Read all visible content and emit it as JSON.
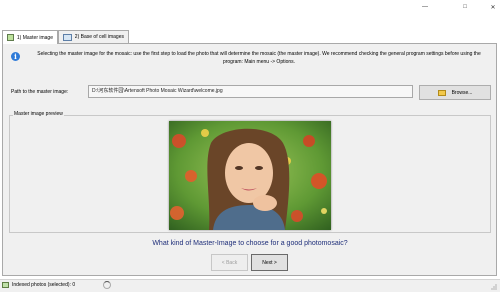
{
  "window": {
    "minimize_glyph": "—",
    "maximize_glyph": "□",
    "close_glyph": "✕"
  },
  "tabs": [
    {
      "label": "1) Master image"
    },
    {
      "label": "2) Base of cell images"
    }
  ],
  "info": {
    "text": "Selecting the master image for the mosaic: use the first step to load the photo that will determine the mosaic (the master image). We recommend checking the general program settings before using the program: Main menu -> Options."
  },
  "path": {
    "label": "Path to the master image:",
    "value": "D:\\河东软件园\\Artensoft Photo Mosaic Wizard\\welcome.jpg",
    "browse_label": "Browse..."
  },
  "preview": {
    "title": "Master image preview"
  },
  "question": "What kind of Master-Image to choose for a good photomosaic?",
  "nav": {
    "back_label": "< Back",
    "next_label": "Next >"
  },
  "status": {
    "text": "Indexed photos (selected): 0"
  }
}
